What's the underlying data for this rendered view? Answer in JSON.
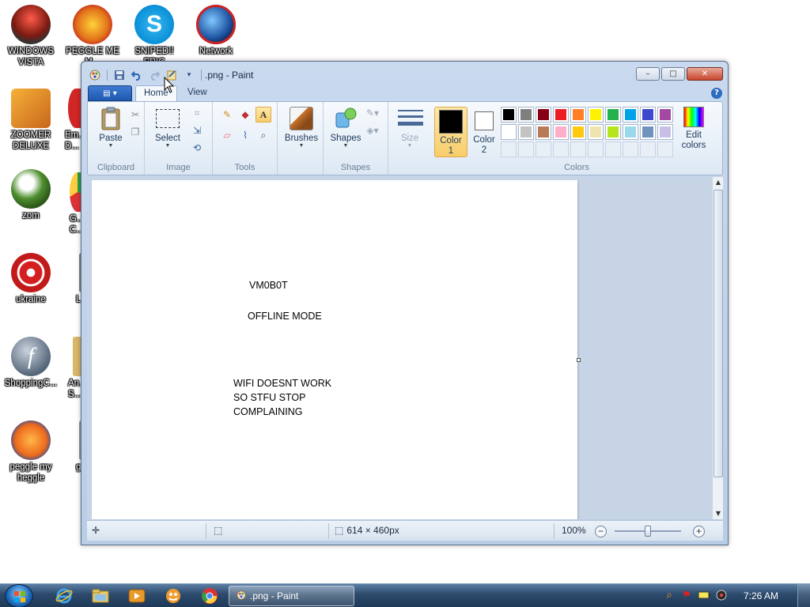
{
  "desktop": {
    "icons": [
      {
        "label": "WINDOWS VISTA"
      },
      {
        "label": "PEGGLE ME M..."
      },
      {
        "label": "SNIPED!! EPIC"
      },
      {
        "label": "Network"
      },
      {
        "label": "ZOOMER DELUXE"
      },
      {
        "label": "Em... D..."
      },
      {
        "label": "zom"
      },
      {
        "label": "G... C..."
      },
      {
        "label": "ukraine"
      },
      {
        "label": "L..."
      },
      {
        "label": "ShoppingC..."
      },
      {
        "label": "An... S..."
      },
      {
        "label": "peggle my heggle"
      },
      {
        "label": "g..."
      }
    ]
  },
  "window": {
    "title": ".png - Paint",
    "qat_icons": [
      "save-icon",
      "undo-icon",
      "redo-icon",
      "customize-icon",
      "dropdown-icon"
    ],
    "controls": {
      "minimize": "–",
      "maximize": "□",
      "close": "✕"
    }
  },
  "ribbon": {
    "tabs": [
      {
        "label": "Home"
      },
      {
        "label": "View"
      }
    ],
    "app_menu_label": "▤ ▾",
    "groups": {
      "clipboard": {
        "label": "Clipboard",
        "paste": "Paste"
      },
      "image": {
        "label": "Image",
        "select": "Select"
      },
      "tools": {
        "label": "Tools"
      },
      "brushes": {
        "label": "Brushes"
      },
      "shapes": {
        "label": "Shapes",
        "shapes_btn": "Shapes"
      },
      "size": {
        "label": "Size"
      },
      "colors": {
        "label": "Colors",
        "color1": "Color\n1",
        "color2": "Color\n2",
        "edit": "Edit\ncolors",
        "color1_value": "#000000",
        "color2_value": "#ffffff",
        "palette_row1": [
          "#000000",
          "#7f7f7f",
          "#880015",
          "#ed1c24",
          "#ff7f27",
          "#fff200",
          "#22b14c",
          "#00a2e8",
          "#3f48cc",
          "#a349a4"
        ],
        "palette_row2": [
          "#ffffff",
          "#c3c3c3",
          "#b97a57",
          "#ffaec9",
          "#ffc90e",
          "#efe4b0",
          "#b5e61d",
          "#99d9ea",
          "#7092be",
          "#c8bfe7"
        ]
      }
    }
  },
  "canvas": {
    "texts": [
      {
        "text": "VM0B0T"
      },
      {
        "text": "OFFLINE MODE"
      },
      {
        "text": "WIFI DOESNT WORK\nSO STFU STOP\nCOMPLAINING"
      }
    ]
  },
  "statusbar": {
    "dimensions": "614 × 460px",
    "zoom": "100%"
  },
  "taskbar": {
    "task_label": ".png - Paint",
    "clock": "7:26 AM",
    "pinned": [
      "ie-icon",
      "explorer-icon",
      "media-player-icon",
      "app-icon",
      "chrome-icon"
    ]
  }
}
